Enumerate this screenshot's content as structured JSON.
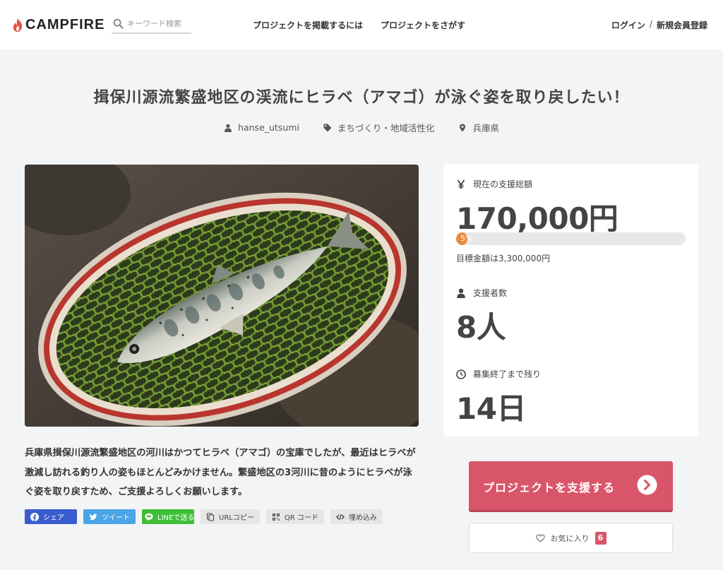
{
  "header": {
    "logo_text": "CAMPFIRE",
    "search_placeholder": "キーワード検索",
    "nav_post": "プロジェクトを掲載するには",
    "nav_find": "プロジェクトをさがす",
    "login": "ログイン",
    "separator": "/",
    "signup": "新規会員登録"
  },
  "project": {
    "title": "揖保川源流繁盛地区の渓流にヒラベ（アマゴ）が泳ぐ姿を取り戻したい！",
    "author": "hanse_utsumi",
    "category": "まちづくり・地域活性化",
    "location": "兵庫県",
    "description": "兵庫県揖保川源流繁盛地区の河川はかつてヒラベ（アマゴ）の宝庫でしたが、最近はヒラベが激減し訪れる釣り人の姿もほとんどみかけません。繁盛地区の3河川に昔のようにヒラベが泳ぐ姿を取り戻すため、ご支援よろしくお願いします。"
  },
  "share": {
    "facebook": "シェア",
    "twitter": "ツイート",
    "line": "LINEで送る",
    "url_copy": "URLコピー",
    "qr": "QR コード",
    "embed": "埋め込み"
  },
  "stats": {
    "total_label": "現在の支援総額",
    "total_value": "170,000円",
    "progress_percent": 5,
    "progress_text": "5%",
    "goal_text": "目標金額は3,300,000円",
    "backers_label": "支援者数",
    "backers_value": "8人",
    "remaining_label": "募集終了まで残り",
    "remaining_value": "14日"
  },
  "actions": {
    "support_label": "プロジェクトを支援する",
    "favorite_label": "お気に入り",
    "favorite_count": "6"
  },
  "colors": {
    "accent": "#d9566a",
    "progress": "#e88a3c",
    "facebook": "#3b5ccf",
    "twitter": "#4aa5e6",
    "line": "#3fbf37"
  }
}
